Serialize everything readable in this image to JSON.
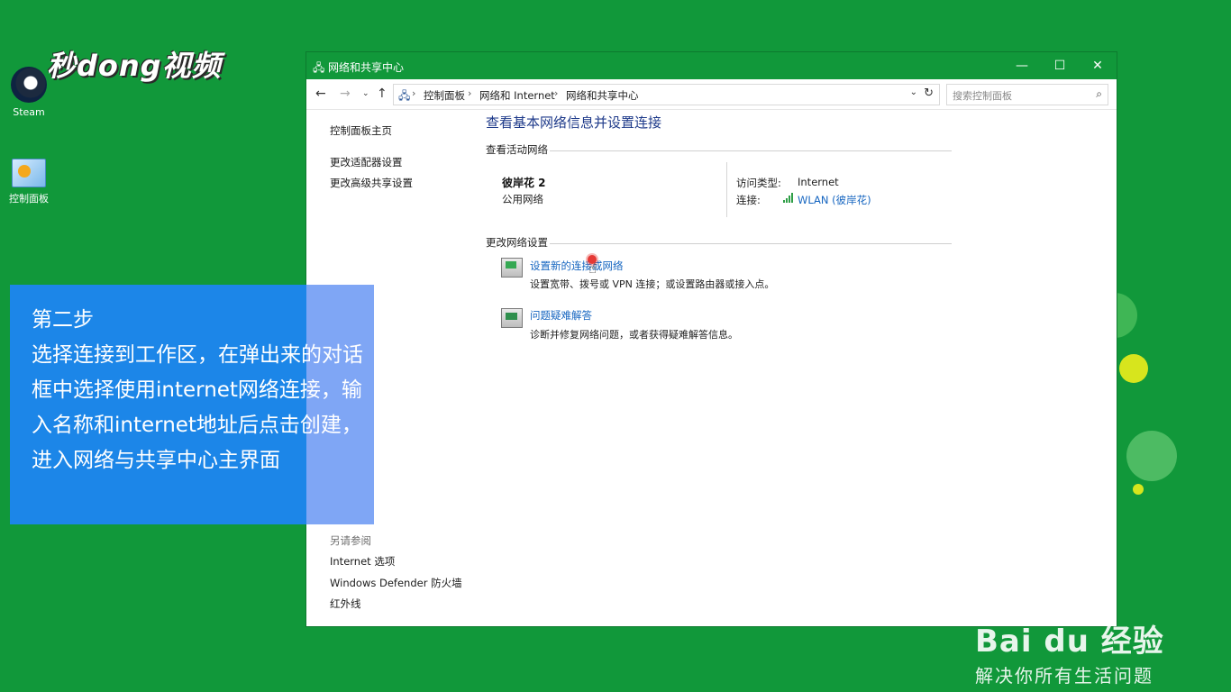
{
  "desktop": {
    "icons": [
      {
        "label": "Steam",
        "icon": "steam-icon"
      },
      {
        "label": "控制面板",
        "icon": "control-panel-icon"
      }
    ],
    "video_logo": "秒dong视频"
  },
  "window": {
    "title": "网络和共享中心",
    "controls": {
      "minimize": "—",
      "maximize": "☐",
      "close": "✕"
    },
    "breadcrumb": [
      "控制面板",
      "网络和 Internet",
      "网络和共享中心"
    ],
    "search_placeholder": "搜索控制面板",
    "left_pane": {
      "home": "控制面板主页",
      "links": [
        "更改适配器设置",
        "更改高级共享设置"
      ],
      "see_also_heading": "另请参阅",
      "see_also": [
        "Internet 选项",
        "Windows Defender 防火墙",
        "红外线"
      ]
    },
    "main": {
      "title": "查看基本网络信息并设置连接",
      "active_networks_heading": "查看活动网络",
      "network": {
        "name": "彼岸花 2",
        "category": "公用网络",
        "access_label": "访问类型:",
        "access_value": "Internet",
        "connection_label": "连接:",
        "connection_value": "WLAN (彼岸花)"
      },
      "change_settings_heading": "更改网络设置",
      "tasks": [
        {
          "link": "设置新的连接或网络",
          "desc": "设置宽带、拨号或 VPN 连接；或设置路由器或接入点。"
        },
        {
          "link": "问题疑难解答",
          "desc": "诊断并修复网络问题，或者获得疑难解答信息。"
        }
      ]
    }
  },
  "caption": "第二步\n选择连接到工作区，在弹出来的对话框中选择使用internet网络连接，输入名称和internet地址后点击创建，进入网络与共享中心主界面",
  "watermark": {
    "brand": "Bai du 经验",
    "slogan": "解决你所有生活问题"
  },
  "colors": {
    "desktop_bg": "#11983a",
    "caption_bg": "#1c86e8",
    "link": "#1565c0",
    "title": "#1e3a8a"
  }
}
